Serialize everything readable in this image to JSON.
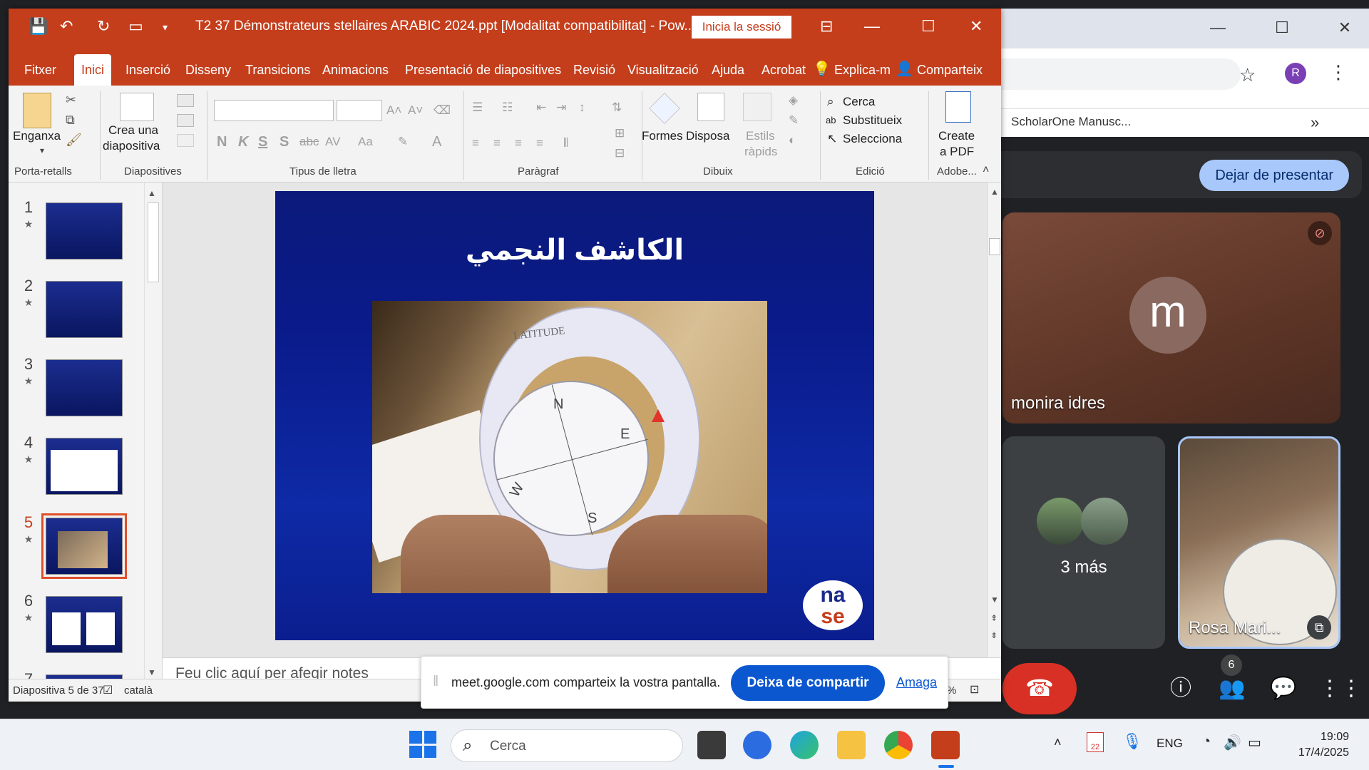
{
  "powerpoint": {
    "doc_title": "T2 37 Démonstrateurs stellaires ARABIC 2024.ppt  [Modalitat compatibilitat]  -  Pow...",
    "signin_label": "Inicia la sessió",
    "tabs": [
      "Fitxer",
      "Inici",
      "Inserció",
      "Disseny",
      "Transicions",
      "Animacions",
      "Presentació de diapositives",
      "Revisió",
      "Visualització",
      "Ajuda",
      "Acrobat",
      "Explica-m",
      "Comparteix"
    ],
    "active_tab": "Inici",
    "ribbon": {
      "paste_label": "Enganxa",
      "clipboard_group": "Porta-retalls",
      "new_slide_label_1": "Crea una",
      "new_slide_label_2": "diapositiva",
      "slides_group": "Diapositives",
      "font_group": "Tipus de lletra",
      "paragraph_group": "Paràgraf",
      "shapes_label": "Formes",
      "arrange_label": "Disposa",
      "quick_styles_label_1": "Estils",
      "quick_styles_label_2": "ràpids",
      "drawing_group": "Dibuix",
      "find_label": "Cerca",
      "replace_label": "Substitueix",
      "select_label": "Selecciona",
      "editing_group": "Edició",
      "create_pdf_label_1": "Create",
      "create_pdf_label_2": "a PDF",
      "adobe_group": "Adobe...",
      "bold": "N",
      "italic": "K",
      "underline": "S",
      "shadow": "S",
      "strike": "abc",
      "spacing": "AV",
      "case": "Aa"
    },
    "thumbnails": [
      {
        "num": "1"
      },
      {
        "num": "2"
      },
      {
        "num": "3"
      },
      {
        "num": "4"
      },
      {
        "num": "5"
      },
      {
        "num": "6"
      },
      {
        "num": "7"
      }
    ],
    "selected_slide": 5,
    "slide_title": "الكاشف النجمي",
    "photo_labels": {
      "latitude": "LATITUDE",
      "north": "N",
      "east": "E",
      "south": "S",
      "west": "W"
    },
    "logo_text_1": "na",
    "logo_text_2": "se",
    "notes_placeholder": "Feu clic aquí per afegir notes",
    "status_slide": "Diapositiva 5 de 37",
    "status_lang": "català",
    "status_zoom_tail": "%"
  },
  "browser": {
    "bookmark": "ScholarOne Manusc...",
    "profile_initial": "R"
  },
  "meet": {
    "stop_presenting": "Dejar de presentar",
    "main_tile_name": "monira idres",
    "main_avatar_letter": "m",
    "more_label": "3 más",
    "rosa_name": "Rosa Mari...",
    "people_count": "6"
  },
  "sharebar": {
    "text": "meet.google.com comparteix la vostra pantalla.",
    "stop_label": "Deixa de compartir",
    "hide_label": "Amaga"
  },
  "taskbar": {
    "search_placeholder": "Cerca",
    "lang": "ENG",
    "calendar_badge": "22",
    "time": "19:09",
    "date": "17/4/2025"
  },
  "colors": {
    "ppt_accent": "#c43e1c",
    "meet_blue": "#a8c7fa",
    "share_blue": "#0b57d0",
    "hangup_red": "#d93025"
  }
}
